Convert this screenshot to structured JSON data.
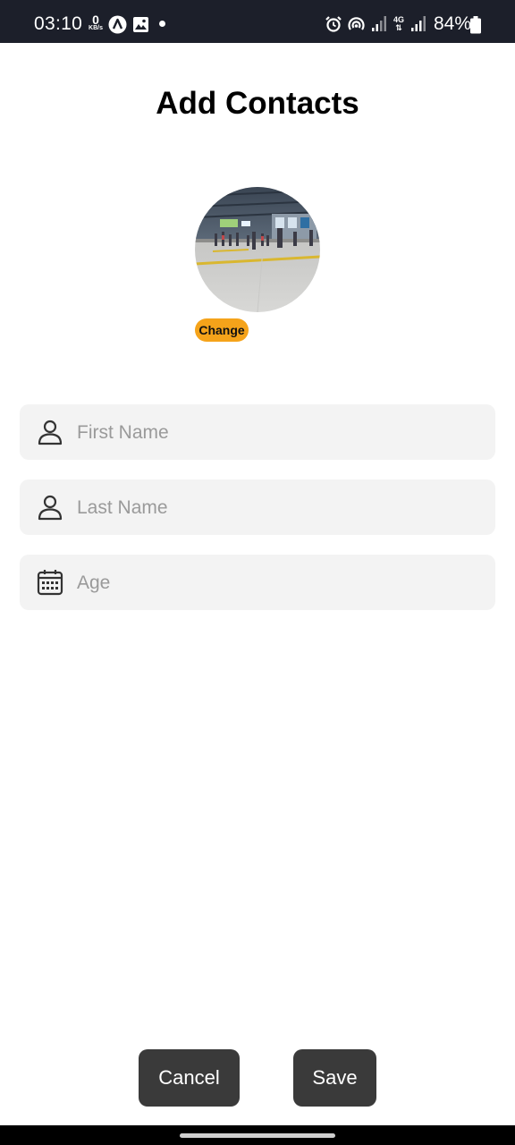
{
  "status_bar": {
    "time": "03:10",
    "data_speed": "0",
    "data_unit": "KB/s",
    "network": "4G",
    "battery": "84%",
    "icons": [
      "app-a-icon",
      "image-icon",
      "alarm-icon",
      "hotspot-icon",
      "signal-icon",
      "battery-icon"
    ]
  },
  "page": {
    "title": "Add Contacts"
  },
  "avatar": {
    "change_label": "Change"
  },
  "form": {
    "first_name": {
      "placeholder": "First Name",
      "value": "",
      "icon": "person-icon"
    },
    "last_name": {
      "placeholder": "Last Name",
      "value": "",
      "icon": "person-icon"
    },
    "age": {
      "placeholder": "Age",
      "value": "",
      "icon": "calendar-icon"
    }
  },
  "actions": {
    "cancel_label": "Cancel",
    "save_label": "Save"
  },
  "colors": {
    "accent": "#f5a31a",
    "button_bg": "#3a3a3a",
    "field_bg": "#f3f3f3",
    "status_bar": "#1c1f2a"
  }
}
